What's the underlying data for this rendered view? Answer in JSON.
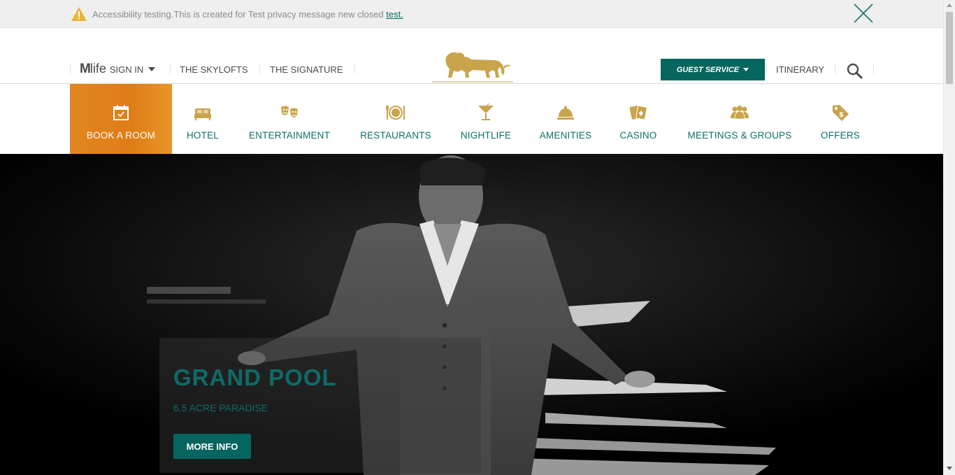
{
  "notice": {
    "icon": "warning-icon",
    "message": "Accessibility testing.This is created for Test privacy message new closed ",
    "link": "test.",
    "close_icon": "close-icon"
  },
  "header": {
    "mlife_logo_m": "M",
    "mlife_logo_life": "life",
    "signin": "SIGN IN",
    "links": [
      "THE SKYLOFTS",
      "THE SIGNATURE"
    ],
    "logo": "lion-logo",
    "guest_service": "GUEST SERVICE",
    "itinerary": "ITINERARY",
    "search_icon": "search-icon"
  },
  "nav": {
    "items": [
      {
        "label": "BOOK A ROOM",
        "icon": "calendar-icon"
      },
      {
        "label": "HOTEL",
        "icon": "bed-icon"
      },
      {
        "label": "ENTERTAINMENT",
        "icon": "theater-masks-icon"
      },
      {
        "label": "RESTAURANTS",
        "icon": "plate-utensils-icon"
      },
      {
        "label": "NIGHTLIFE",
        "icon": "cocktail-icon"
      },
      {
        "label": "AMENITIES",
        "icon": "service-bell-icon"
      },
      {
        "label": "CASINO",
        "icon": "playing-cards-icon"
      },
      {
        "label": "MEETINGS & GROUPS",
        "icon": "group-icon"
      },
      {
        "label": "OFFERS",
        "icon": "price-tag-icon"
      }
    ]
  },
  "hero": {
    "title": "GRAND POOL",
    "subtitle": "6.5 ACRE PARADISE",
    "button": "MORE INFO"
  },
  "colors": {
    "teal": "#05655f",
    "orange": "#e1861f",
    "gold": "#c9a44c",
    "notice_bg": "#efefef"
  }
}
